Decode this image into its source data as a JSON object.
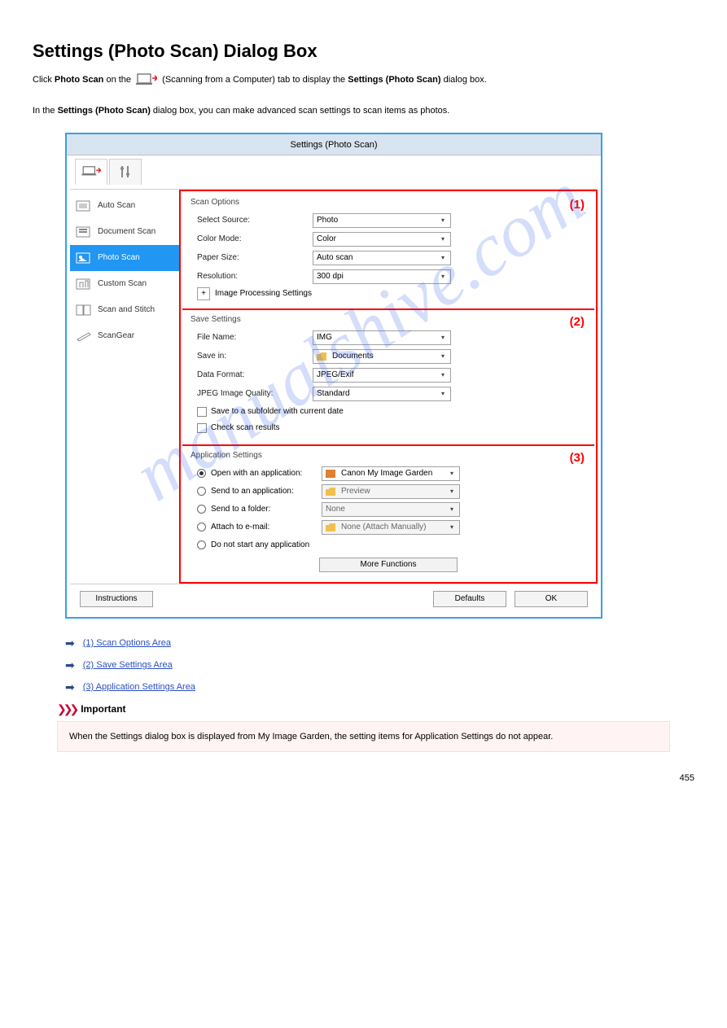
{
  "page": {
    "title": "Settings (Photo Scan) Dialog Box",
    "intro_prefix": "Click ",
    "intro_bold": "Photo Scan",
    "intro_mid": " on the ",
    "intro_tab": " (Scanning from a Computer) tab to display the ",
    "intro_dlg": "Settings (Photo Scan)",
    "intro_end": " dialog box.",
    "desc_prefix": "In the ",
    "desc_bold": "Settings (Photo Scan)",
    "desc_rest": " dialog box, you can make advanced scan settings to scan items as photos."
  },
  "dialog": {
    "title": "Settings (Photo Scan)"
  },
  "sidebar": {
    "items": [
      {
        "label": "Auto Scan"
      },
      {
        "label": "Document Scan"
      },
      {
        "label": "Photo Scan"
      },
      {
        "label": "Custom Scan"
      },
      {
        "label": "Scan and Stitch"
      },
      {
        "label": "ScanGear"
      }
    ]
  },
  "scan_options": {
    "legend": "Scan Options",
    "number": "(1)",
    "select_source_label": "Select Source:",
    "select_source_value": "Photo",
    "color_mode_label": "Color Mode:",
    "color_mode_value": "Color",
    "paper_size_label": "Paper Size:",
    "paper_size_value": "Auto scan",
    "resolution_label": "Resolution:",
    "resolution_value": "300 dpi",
    "image_processing": "Image Processing Settings"
  },
  "save_settings": {
    "legend": "Save Settings",
    "number": "(2)",
    "file_name_label": "File Name:",
    "file_name_value": "IMG",
    "save_in_label": "Save in:",
    "save_in_value": "Documents",
    "data_format_label": "Data Format:",
    "data_format_value": "JPEG/Exif",
    "jpeg_quality_label": "JPEG Image Quality:",
    "jpeg_quality_value": "Standard",
    "subfolder": "Save to a subfolder with current date",
    "check_results": "Check scan results"
  },
  "app_settings": {
    "legend": "Application Settings",
    "number": "(3)",
    "open_with_label": "Open with an application:",
    "open_with_value": "Canon My Image Garden",
    "send_app_label": "Send to an application:",
    "send_app_value": "Preview",
    "send_folder_label": "Send to a folder:",
    "send_folder_value": "None",
    "attach_email_label": "Attach to e-mail:",
    "attach_email_value": "None (Attach Manually)",
    "no_app_label": "Do not start any application",
    "more_functions": "More Functions"
  },
  "footer": {
    "instructions": "Instructions",
    "defaults": "Defaults",
    "ok": "OK"
  },
  "links": {
    "l1": "(1) Scan Options Area",
    "l2": "(2) Save Settings Area",
    "l3": "(3) Application Settings Area"
  },
  "important": {
    "heading": "Important",
    "text": "When the Settings dialog box is displayed from My Image Garden, the setting items for Application Settings do not appear."
  },
  "watermark": "manualshive.com",
  "pagenum": "455"
}
